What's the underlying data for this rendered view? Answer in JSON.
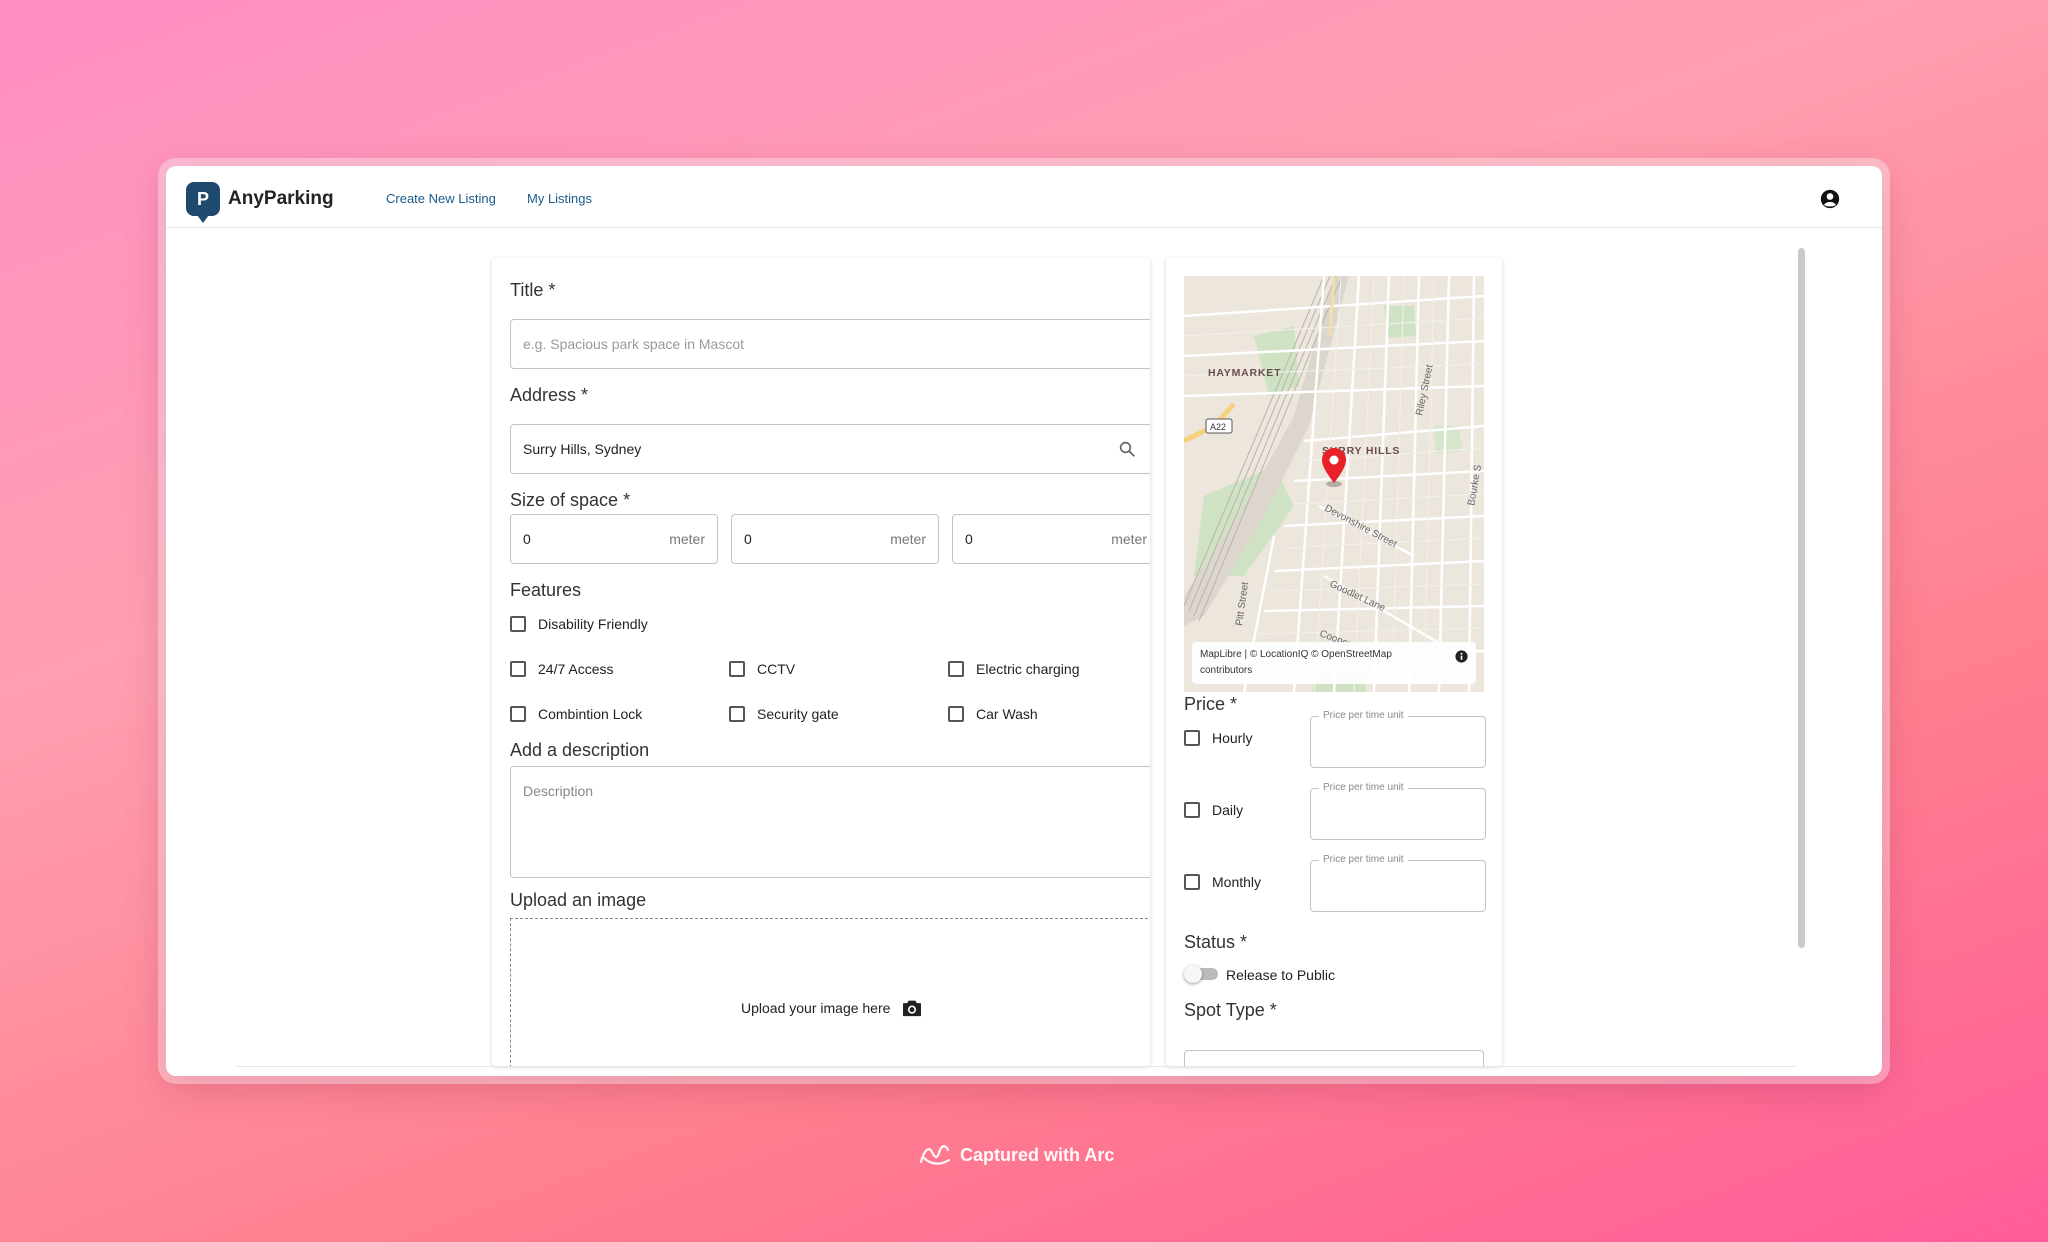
{
  "app": {
    "brand": "AnyParking",
    "logo_letter": "P",
    "brand_color": "#1f4a6e"
  },
  "nav": {
    "create_listing": "Create New Listing",
    "my_listings": "My Listings",
    "account_icon": "account-circle-icon"
  },
  "form": {
    "title_label": "Title *",
    "title_placeholder": "e.g. Spacious park space in Mascot",
    "address_label": "Address *",
    "address_value": "Surry Hills, Sydney",
    "size_label": "Size of space *",
    "size_fields": [
      {
        "value": "0",
        "unit": "meter"
      },
      {
        "value": "0",
        "unit": "meter"
      },
      {
        "value": "0",
        "unit": "meter"
      }
    ],
    "features_label": "Features",
    "features": [
      "Disability Friendly",
      "24/7 Access",
      "CCTV",
      "Electric charging",
      "Combintion Lock",
      "Security gate",
      "Car Wash"
    ],
    "description_label": "Add a description",
    "description_placeholder": "Description",
    "upload_label": "Upload an image",
    "upload_text": "Upload your image here"
  },
  "map": {
    "labels": {
      "haymarket": "HAYMARKET",
      "surry_hills": "SURRY HILLS",
      "a22": "A22",
      "devonshire": "Devonshire Street",
      "goodlet": "Goodlet Lane",
      "riley": "Riley Street",
      "pitt": "Pitt Street",
      "bourke": "Bourke S",
      "cooper": "Cooper"
    },
    "attribution_line1": "MapLibre | © LocationIQ © OpenStreetMap",
    "attribution_line2": "contributors",
    "marker_color": "#e8202a"
  },
  "pricing": {
    "label": "Price *",
    "options": [
      {
        "name": "Hourly",
        "legend": "Price per time unit"
      },
      {
        "name": "Daily",
        "legend": "Price per time unit"
      },
      {
        "name": "Monthly",
        "legend": "Price per time unit"
      }
    ]
  },
  "status": {
    "label": "Status *",
    "toggle_label": "Release to Public"
  },
  "spot_type": {
    "label": "Spot Type *"
  },
  "footer": {
    "text": "Captured with Arc"
  }
}
